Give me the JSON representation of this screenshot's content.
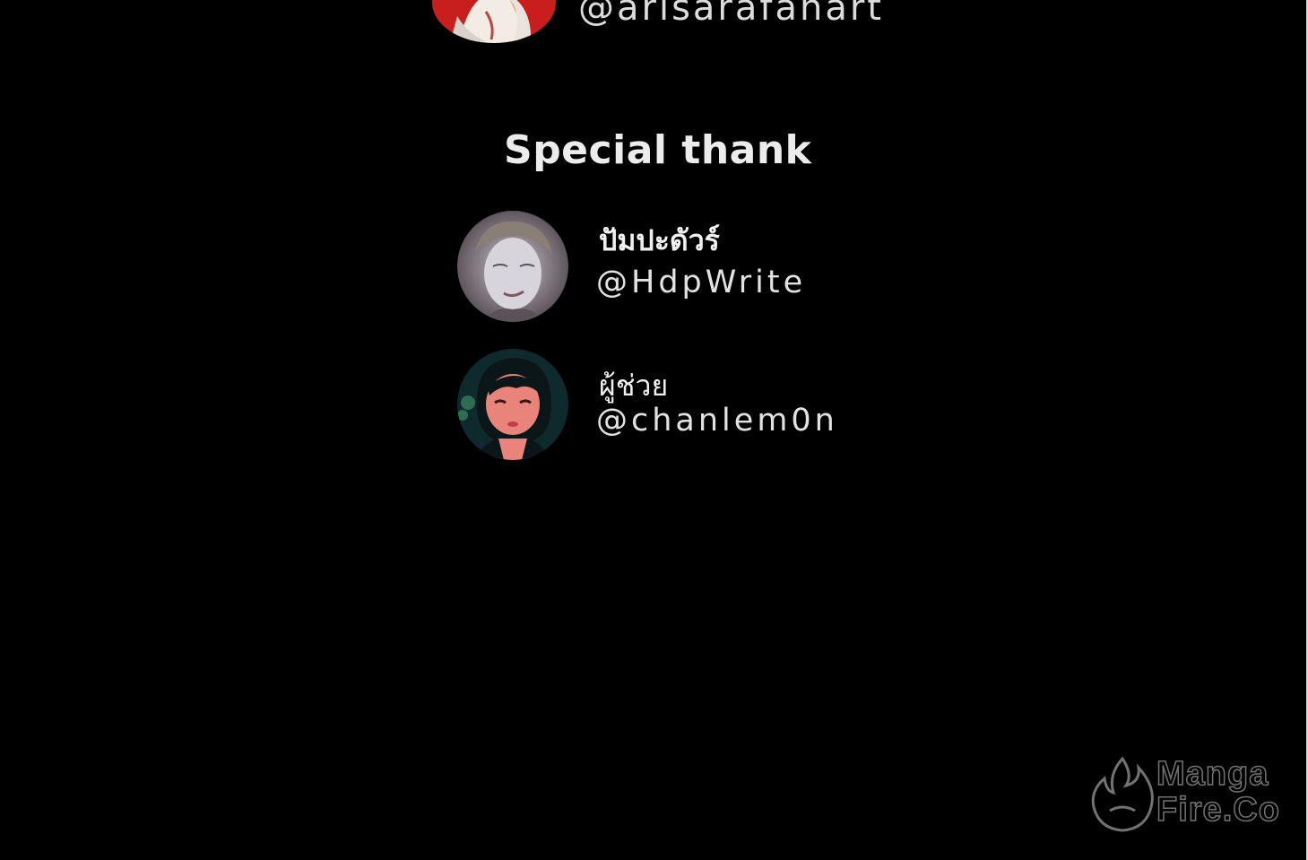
{
  "top_credit": {
    "handle": "@arisarafanart"
  },
  "special_thanks": {
    "title": "Special thank",
    "people": [
      {
        "name": "ปัมปะดัวร์",
        "handle": "@HdpWrite"
      },
      {
        "name": "ผู้ช่วย",
        "handle": "@chanlem0n"
      }
    ]
  },
  "watermark": {
    "line1": "Manga",
    "line2": "Fire.Co",
    "icon": "flame-logo-icon"
  },
  "colors": {
    "background": "#000000",
    "text": "#e8e8e8",
    "avatar_red": "#c81e1e"
  }
}
